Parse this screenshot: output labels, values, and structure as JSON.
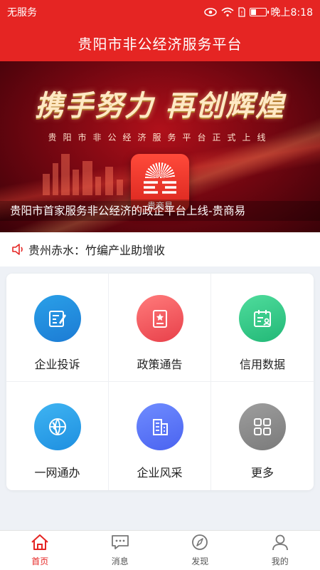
{
  "status_bar": {
    "carrier": "无服务",
    "time": "晚上8:18",
    "battery_level": 0.35,
    "icons": [
      "eye-icon",
      "wifi-icon",
      "sim-icon",
      "battery-icon"
    ]
  },
  "header": {
    "title": "贵阳市非公经济服务平台"
  },
  "banner": {
    "slogan": "携手努力 再创辉煌",
    "subtitle": "贵阳市非公经济服务平台正式上线",
    "logo_caption": "贵商易",
    "caption": "贵阳市首家服务非公经济的政企平台上线-贵商易"
  },
  "notice": {
    "text": "贵州赤水：竹编产业助增收",
    "icon": "speaker-icon"
  },
  "grid": {
    "items": [
      {
        "label": "企业投诉",
        "icon": "complaint-icon",
        "color_from": "#2aa0e8",
        "color_to": "#1c7bd4"
      },
      {
        "label": "政策通告",
        "icon": "policy-icon",
        "color_from": "#ff7b7b",
        "color_to": "#e8404a"
      },
      {
        "label": "信用数据",
        "icon": "credit-icon",
        "color_from": "#4fdc9c",
        "color_to": "#22b877"
      },
      {
        "label": "一网通办",
        "icon": "globe-icon",
        "color_from": "#3fb4f2",
        "color_to": "#1e8fe0"
      },
      {
        "label": "企业风采",
        "icon": "building-icon",
        "color_from": "#6f8cff",
        "color_to": "#4a63f0"
      },
      {
        "label": "更多",
        "icon": "more-icon",
        "color_from": "#9e9e9e",
        "color_to": "#7a7a7a"
      }
    ]
  },
  "tabbar": {
    "active_color": "#e52523",
    "items": [
      {
        "label": "首页",
        "icon": "home-icon",
        "active": true
      },
      {
        "label": "消息",
        "icon": "message-icon",
        "active": false
      },
      {
        "label": "发现",
        "icon": "compass-icon",
        "active": false
      },
      {
        "label": "我的",
        "icon": "user-icon",
        "active": false
      }
    ]
  }
}
